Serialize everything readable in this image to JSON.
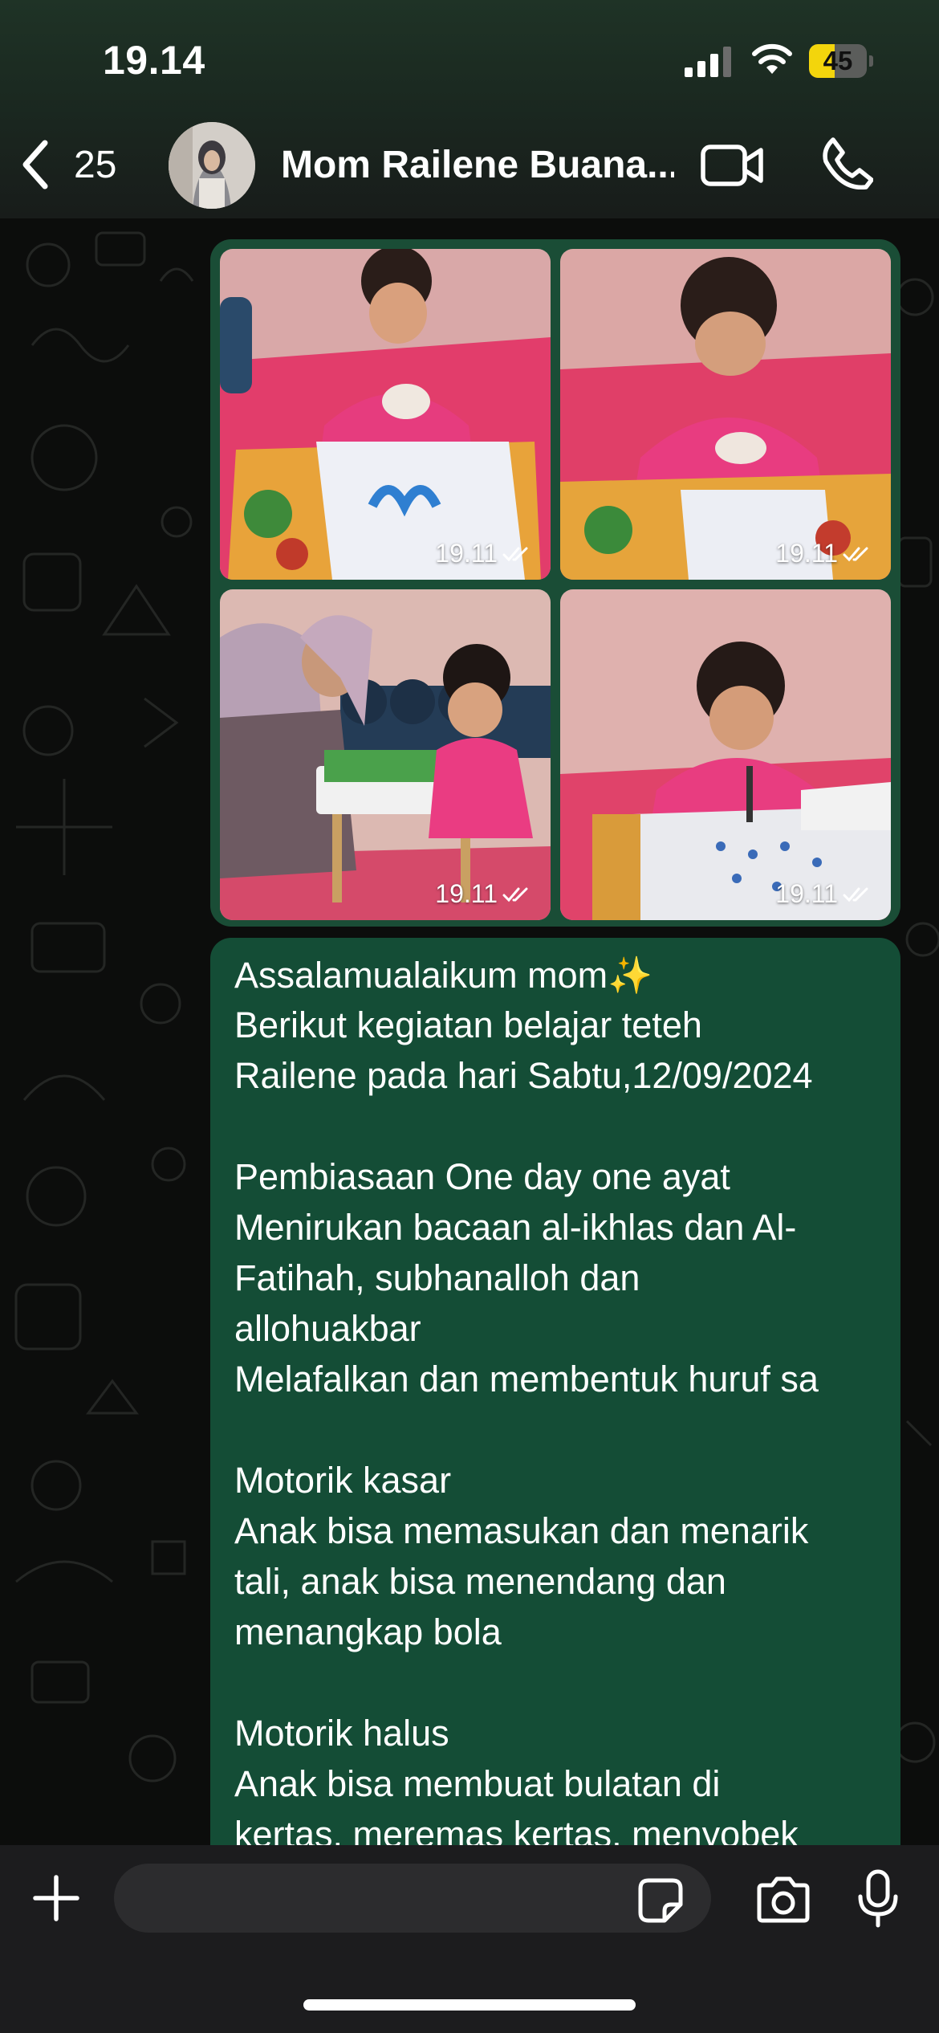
{
  "status_bar": {
    "time": "19.14",
    "battery": "45",
    "battery_level": 0.45
  },
  "header": {
    "unread_count": "25",
    "contact_name": "Mom Railene Buana..."
  },
  "photos": [
    {
      "timestamp": "19.11",
      "icon": "double-check-icon"
    },
    {
      "timestamp": "19.11",
      "icon": "double-check-icon"
    },
    {
      "timestamp": "19.11",
      "icon": "double-check-icon"
    },
    {
      "timestamp": "19.11",
      "icon": "double-check-icon"
    }
  ],
  "message": {
    "lines": [
      "Assalamualaikum mom✨",
      "Berikut kegiatan belajar teteh",
      "Railene pada hari Sabtu,12/09/2024",
      "",
      "Pembiasaan One day one ayat",
      "Menirukan bacaan al-ikhlas dan Al-",
      "Fatihah, subhanalloh dan",
      "allohuakbar",
      "Melafalkan dan membentuk huruf sa",
      "",
      "Motorik kasar",
      "Anak bisa memasukan dan menarik",
      "tali, anak bisa menendang dan",
      "menangkap bola",
      "",
      "Motorik halus",
      "Anak bisa membuat bulatan di",
      "kertas, meremas kertas, menyobek"
    ]
  },
  "composer": {
    "placeholder": ""
  },
  "colors": {
    "bubble": "#144d36",
    "accent": "#25d366",
    "header_bg": "#1b2a21"
  }
}
